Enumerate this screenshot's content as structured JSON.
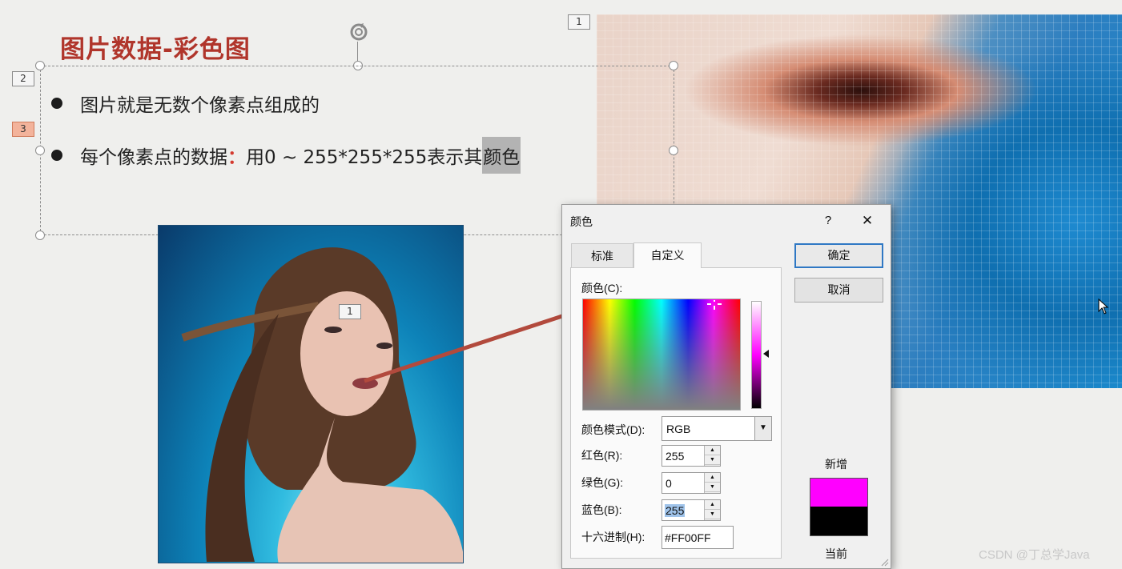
{
  "slide": {
    "title": "图片数据-彩色图",
    "bullets": [
      {
        "text": "图片就是无数个像素点组成的"
      },
      {
        "prefix": "每个像素点的数据",
        "colon": "：",
        "body": "用0 ~ 255*255*255表示其",
        "highlight": "颜色"
      }
    ],
    "tags": {
      "tag_top": "1",
      "tag_2": "2",
      "tag_3": "3",
      "tag_portrait": "1"
    }
  },
  "dialog": {
    "title": "颜色",
    "help": "?",
    "close": "✕",
    "tabs": [
      {
        "label": "标准"
      },
      {
        "label": "自定义"
      }
    ],
    "colors_label": "颜色(C):",
    "mode_label": "颜色模式(D):",
    "mode_value": "RGB",
    "red_label": "红色(R):",
    "red_value": "255",
    "green_label": "绿色(G):",
    "green_value": "0",
    "blue_label": "蓝色(B):",
    "blue_value": "255",
    "hex_label": "十六进制(H):",
    "hex_value": "#FF00FF",
    "ok_label": "确定",
    "cancel_label": "取消",
    "new_label": "新增",
    "current_label": "当前",
    "new_color": "#FF00FF",
    "current_color": "#000000"
  },
  "watermark": "CSDN @丁总学Java"
}
